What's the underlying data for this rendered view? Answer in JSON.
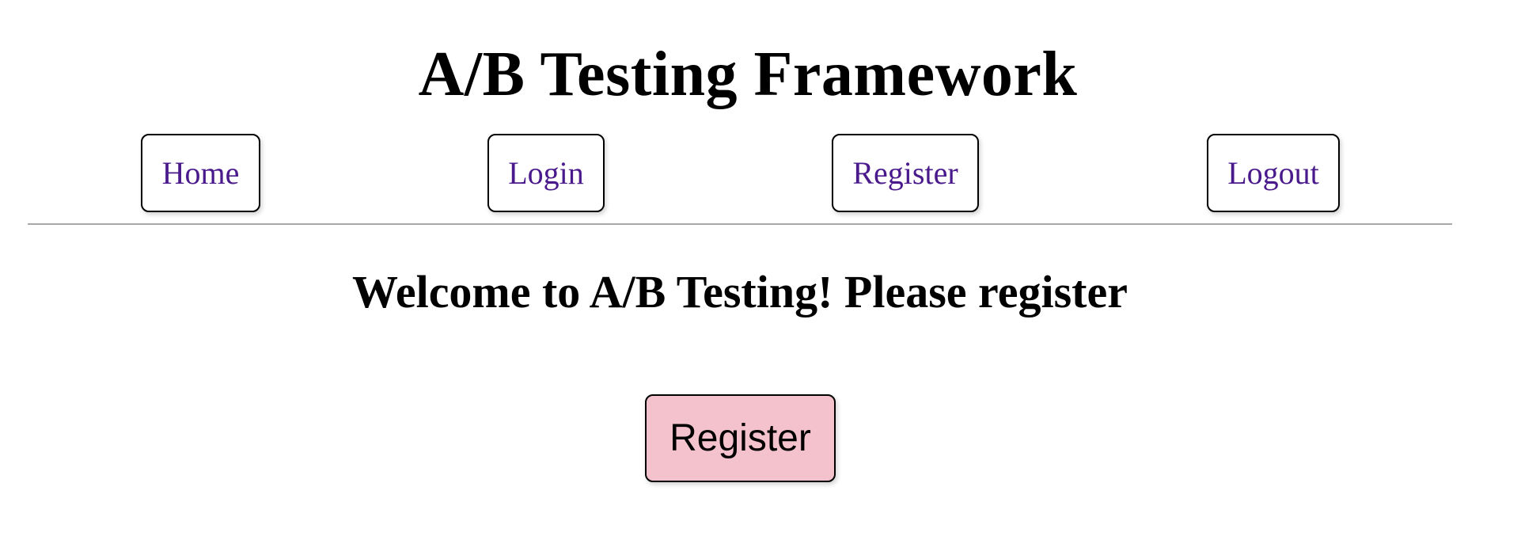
{
  "header": {
    "title": "A/B Testing Framework"
  },
  "nav": {
    "items": [
      {
        "label": "Home"
      },
      {
        "label": "Login"
      },
      {
        "label": "Register"
      },
      {
        "label": "Logout"
      }
    ]
  },
  "main": {
    "heading": "Welcome to A/B Testing! Please register",
    "register_button_label": "Register"
  },
  "colors": {
    "nav_link_text": "#4a1a8c",
    "register_button_bg": "#f4c2cc",
    "divider": "#a8a8a8"
  }
}
